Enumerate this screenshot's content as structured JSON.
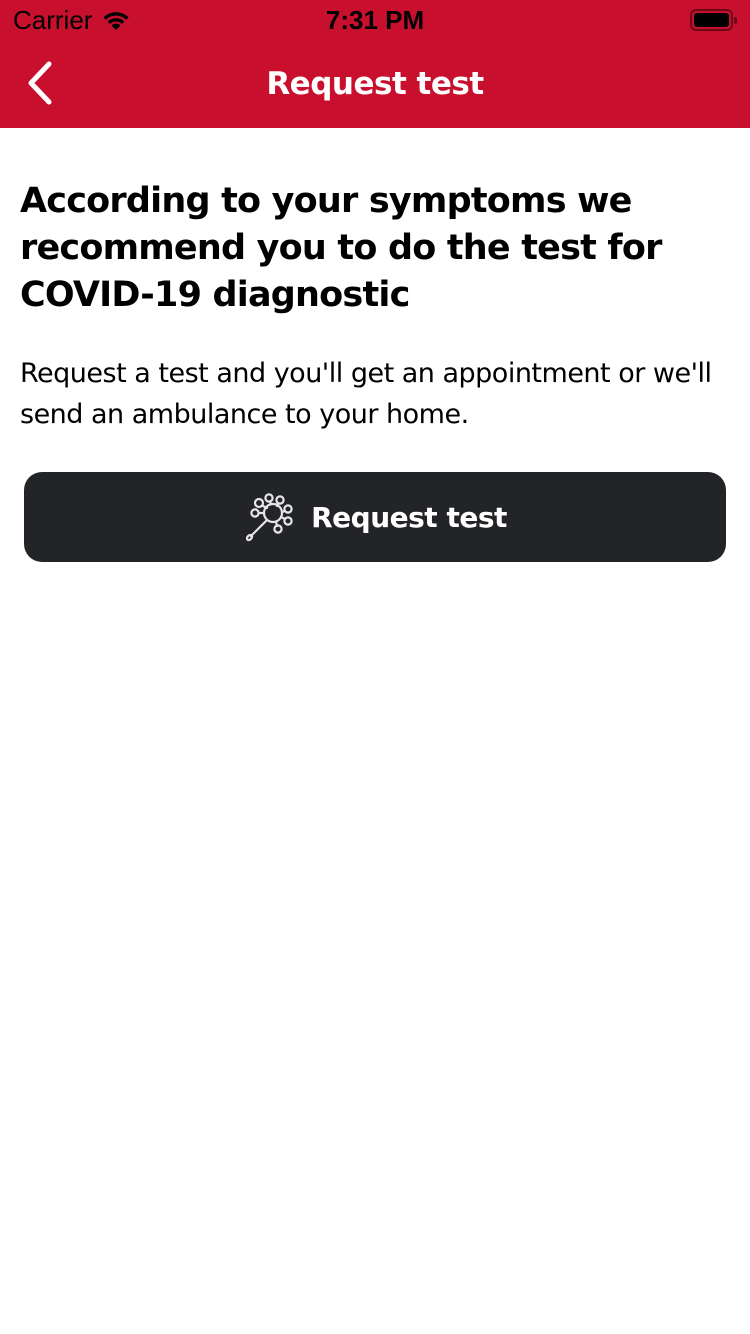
{
  "status_bar": {
    "carrier": "Carrier",
    "time": "7:31 PM"
  },
  "nav": {
    "title": "Request test",
    "back_icon": "chevron-left-icon"
  },
  "main": {
    "headline": "According to your symptoms we recommend you to do the test for COVID-19 diagnostic",
    "description": "Request a test and you'll get an appointment or we'll send an ambulance to your home.",
    "request_button": {
      "label": "Request test",
      "icon": "virus-swab-icon"
    }
  },
  "colors": {
    "header": "#c8102e",
    "button": "#232427",
    "text": "#000000"
  }
}
